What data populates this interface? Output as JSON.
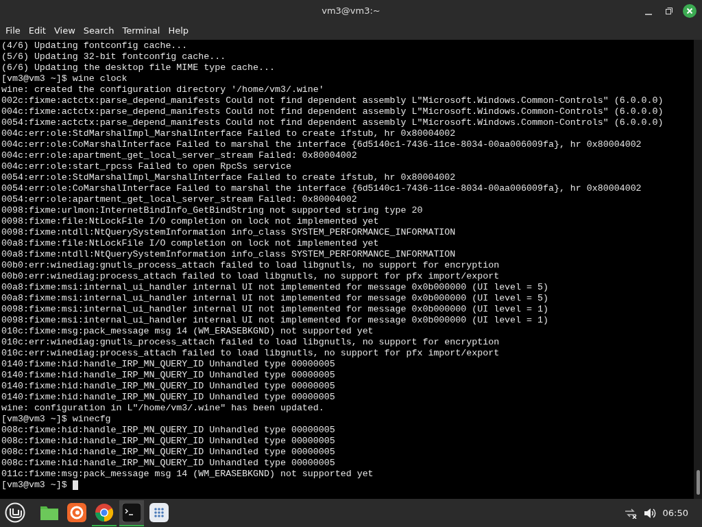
{
  "window": {
    "title": "vm3@vm3:~"
  },
  "menu": [
    "File",
    "Edit",
    "View",
    "Search",
    "Terminal",
    "Help"
  ],
  "terminal": {
    "lines": [
      "(4/6) Updating fontconfig cache...",
      "(5/6) Updating 32-bit fontconfig cache...",
      "(6/6) Updating the desktop file MIME type cache...",
      "[vm3@vm3 ~]$ wine clock",
      "wine: created the configuration directory '/home/vm3/.wine'",
      "002c:fixme:actctx:parse_depend_manifests Could not find dependent assembly L\"Microsoft.Windows.Common-Controls\" (6.0.0.0)",
      "004c:fixme:actctx:parse_depend_manifests Could not find dependent assembly L\"Microsoft.Windows.Common-Controls\" (6.0.0.0)",
      "0054:fixme:actctx:parse_depend_manifests Could not find dependent assembly L\"Microsoft.Windows.Common-Controls\" (6.0.0.0)",
      "004c:err:ole:StdMarshalImpl_MarshalInterface Failed to create ifstub, hr 0x80004002",
      "004c:err:ole:CoMarshalInterface Failed to marshal the interface {6d5140c1-7436-11ce-8034-00aa006009fa}, hr 0x80004002",
      "004c:err:ole:apartment_get_local_server_stream Failed: 0x80004002",
      "004c:err:ole:start_rpcss Failed to open RpcSs service",
      "0054:err:ole:StdMarshalImpl_MarshalInterface Failed to create ifstub, hr 0x80004002",
      "0054:err:ole:CoMarshalInterface Failed to marshal the interface {6d5140c1-7436-11ce-8034-00aa006009fa}, hr 0x80004002",
      "0054:err:ole:apartment_get_local_server_stream Failed: 0x80004002",
      "0098:fixme:urlmon:InternetBindInfo_GetBindString not supported string type 20",
      "0098:fixme:file:NtLockFile I/O completion on lock not implemented yet",
      "0098:fixme:ntdll:NtQuerySystemInformation info_class SYSTEM_PERFORMANCE_INFORMATION",
      "00a8:fixme:file:NtLockFile I/O completion on lock not implemented yet",
      "00a8:fixme:ntdll:NtQuerySystemInformation info_class SYSTEM_PERFORMANCE_INFORMATION",
      "00b0:err:winediag:gnutls_process_attach failed to load libgnutls, no support for encryption",
      "00b0:err:winediag:process_attach failed to load libgnutls, no support for pfx import/export",
      "00a8:fixme:msi:internal_ui_handler internal UI not implemented for message 0x0b000000 (UI level = 5)",
      "00a8:fixme:msi:internal_ui_handler internal UI not implemented for message 0x0b000000 (UI level = 5)",
      "0098:fixme:msi:internal_ui_handler internal UI not implemented for message 0x0b000000 (UI level = 1)",
      "0098:fixme:msi:internal_ui_handler internal UI not implemented for message 0x0b000000 (UI level = 1)",
      "010c:fixme:msg:pack_message msg 14 (WM_ERASEBKGND) not supported yet",
      "010c:err:winediag:gnutls_process_attach failed to load libgnutls, no support for encryption",
      "010c:err:winediag:process_attach failed to load libgnutls, no support for pfx import/export",
      "0140:fixme:hid:handle_IRP_MN_QUERY_ID Unhandled type 00000005",
      "0140:fixme:hid:handle_IRP_MN_QUERY_ID Unhandled type 00000005",
      "0140:fixme:hid:handle_IRP_MN_QUERY_ID Unhandled type 00000005",
      "0140:fixme:hid:handle_IRP_MN_QUERY_ID Unhandled type 00000005",
      "wine: configuration in L\"/home/vm3/.wine\" has been updated.",
      "[vm3@vm3 ~]$ winecfg",
      "008c:fixme:hid:handle_IRP_MN_QUERY_ID Unhandled type 00000005",
      "008c:fixme:hid:handle_IRP_MN_QUERY_ID Unhandled type 00000005",
      "008c:fixme:hid:handle_IRP_MN_QUERY_ID Unhandled type 00000005",
      "008c:fixme:hid:handle_IRP_MN_QUERY_ID Unhandled type 00000005",
      "011c:fixme:msg:pack_message msg 14 (WM_ERASEBKGND) not supported yet"
    ],
    "prompt": "[vm3@vm3 ~]$"
  },
  "taskbar": {
    "apps": [
      {
        "kind": "menu",
        "running": false,
        "selected": false
      },
      {
        "kind": "files",
        "running": false,
        "selected": false
      },
      {
        "kind": "firefox",
        "running": false,
        "selected": false
      },
      {
        "kind": "chrome",
        "running": true,
        "selected": false
      },
      {
        "kind": "terminal",
        "running": true,
        "selected": true
      },
      {
        "kind": "apps",
        "running": false,
        "selected": false
      }
    ],
    "clock": "06:50"
  }
}
